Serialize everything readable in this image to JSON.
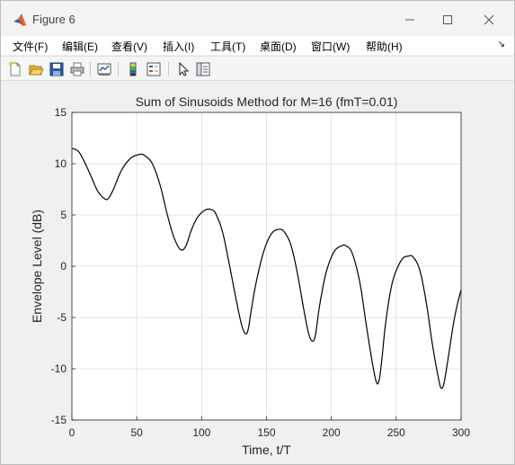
{
  "window": {
    "title": "Figure 6",
    "icon": "matlab-icon",
    "controls": [
      "minimize-icon",
      "maximize-icon",
      "close-icon"
    ]
  },
  "menubar": {
    "items": [
      {
        "label": "文件(F)"
      },
      {
        "label": "编辑(E)"
      },
      {
        "label": "查看(V)"
      },
      {
        "label": "插入(I)"
      },
      {
        "label": "工具(T)"
      },
      {
        "label": "桌面(D)"
      },
      {
        "label": "窗口(W)"
      },
      {
        "label": "帮助(H)"
      }
    ]
  },
  "toolbar": {
    "buttons": [
      "new-figure-icon",
      "open-file-icon",
      "save-icon",
      "print-icon",
      "link-plot-icon",
      "colorbar-icon",
      "legend-icon",
      "pointer-icon",
      "property-editor-icon"
    ]
  },
  "chart_data": {
    "type": "line",
    "title": "Sum of Sinusoids Method for M=16 (fmT=0.01)",
    "xlabel": "Time, t/T",
    "ylabel": "Envelope Level (dB)",
    "xlim": [
      0,
      300
    ],
    "ylim": [
      -15,
      15
    ],
    "xticks": [
      "0",
      "50",
      "100",
      "150",
      "200",
      "250",
      "300"
    ],
    "yticks": [
      "15",
      "10",
      "5",
      "0",
      "-5",
      "-10",
      "-15"
    ],
    "grid": true,
    "line_color": "#000000",
    "series": [
      {
        "x": [
          0,
          5,
          10,
          15,
          20,
          25,
          28,
          32,
          38,
          45,
          52,
          56,
          62,
          68,
          74,
          79,
          84,
          88,
          92,
          97,
          103,
          108,
          111,
          116,
          121,
          127,
          131,
          134,
          136,
          138,
          142,
          148,
          154,
          160,
          164,
          169,
          174,
          179,
          183,
          186,
          188,
          191,
          196,
          202,
          208,
          211,
          216,
          222,
          227,
          232,
          235,
          237,
          239,
          242,
          247,
          254,
          260,
          263,
          268,
          273,
          278,
          283,
          285,
          287,
          290,
          294,
          297,
          300
        ],
        "y": [
          11.5,
          11.2,
          10.1,
          8.7,
          7.3,
          6.6,
          6.6,
          7.5,
          9.3,
          10.5,
          10.9,
          10.8,
          10.0,
          7.9,
          4.8,
          2.7,
          1.6,
          2.0,
          3.5,
          4.8,
          5.5,
          5.5,
          5.1,
          3.4,
          0.4,
          -3.5,
          -5.8,
          -6.6,
          -6.1,
          -4.5,
          -1.6,
          1.5,
          3.2,
          3.6,
          3.3,
          2.0,
          -0.8,
          -4.4,
          -6.8,
          -7.3,
          -6.5,
          -3.8,
          -0.6,
          1.4,
          2.0,
          2.0,
          1.3,
          -1.6,
          -5.8,
          -9.7,
          -11.4,
          -11.0,
          -9.0,
          -5.4,
          -1.6,
          0.6,
          1.0,
          0.9,
          -0.3,
          -3.4,
          -7.7,
          -11.2,
          -11.9,
          -11.3,
          -9.0,
          -5.7,
          -3.8,
          -2.3
        ]
      }
    ]
  }
}
